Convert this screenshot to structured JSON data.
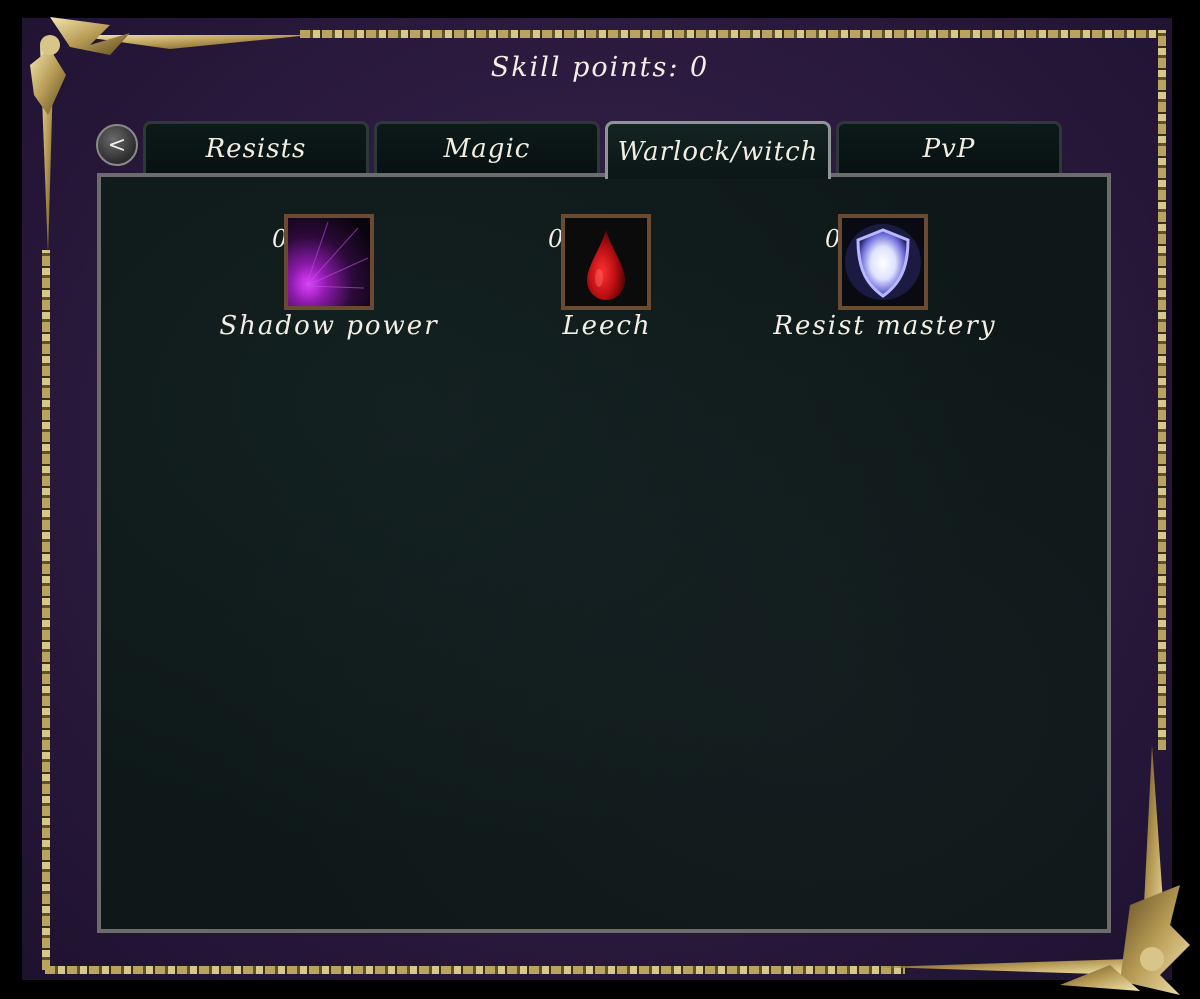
{
  "header": {
    "skill_points_label": "Skill points: 0"
  },
  "tabs": [
    {
      "label": "Resists",
      "active": false
    },
    {
      "label": "Magic",
      "active": false
    },
    {
      "label": "Warlock/witch",
      "active": true
    },
    {
      "label": "PvP",
      "active": false
    }
  ],
  "back_button": {
    "label": "<"
  },
  "skills": [
    {
      "name": "Shadow power",
      "points": "0",
      "icon": "shadow-burst-icon"
    },
    {
      "name": "Leech",
      "points": "0",
      "icon": "blood-drop-icon"
    },
    {
      "name": "Resist mastery",
      "points": "0",
      "icon": "glowing-shield-icon"
    }
  ],
  "colors": {
    "frame_purple": "#2b1a3e",
    "panel_bg": "#0e1818",
    "gold": "#b9a35e",
    "text": "#f3efe6"
  }
}
